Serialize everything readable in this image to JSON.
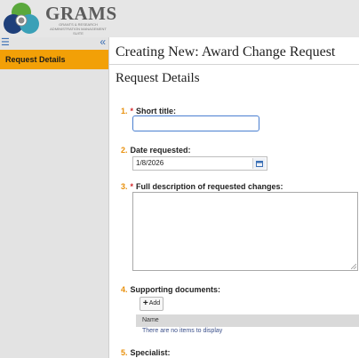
{
  "header": {
    "brand_title": "GRAMS",
    "brand_subtitle": "GRANTS & RESEARCH ADMINISTRATION MANAGEMENT SUITE",
    "colors": {
      "green": "#5aa83c",
      "navy": "#1e3f7a",
      "teal": "#3aa0b7",
      "gray": "#8a8a8a"
    }
  },
  "sidebar": {
    "menu_icon": "hamburger-icon",
    "collapse_icon": "double-chevron-left-icon",
    "items": [
      {
        "label": "Request Details",
        "active": true
      }
    ],
    "accent": "#f2a007"
  },
  "main": {
    "page_title": "Creating New: Award Change Request",
    "section_title": "Request Details",
    "questions": [
      {
        "num": "1.",
        "required": "*",
        "label": "Short title:",
        "value": ""
      },
      {
        "num": "2.",
        "required": "",
        "label": "Date requested:",
        "value": "1/8/2026"
      },
      {
        "num": "3.",
        "required": "*",
        "label": "Full description of requested changes:",
        "value": ""
      },
      {
        "num": "4.",
        "required": "",
        "label": "Supporting documents:"
      },
      {
        "num": "5.",
        "required": "",
        "label": "Specialist:"
      }
    ],
    "documents": {
      "add_label": "Add",
      "column_name": "Name",
      "empty_text": "There are no items to display"
    }
  }
}
